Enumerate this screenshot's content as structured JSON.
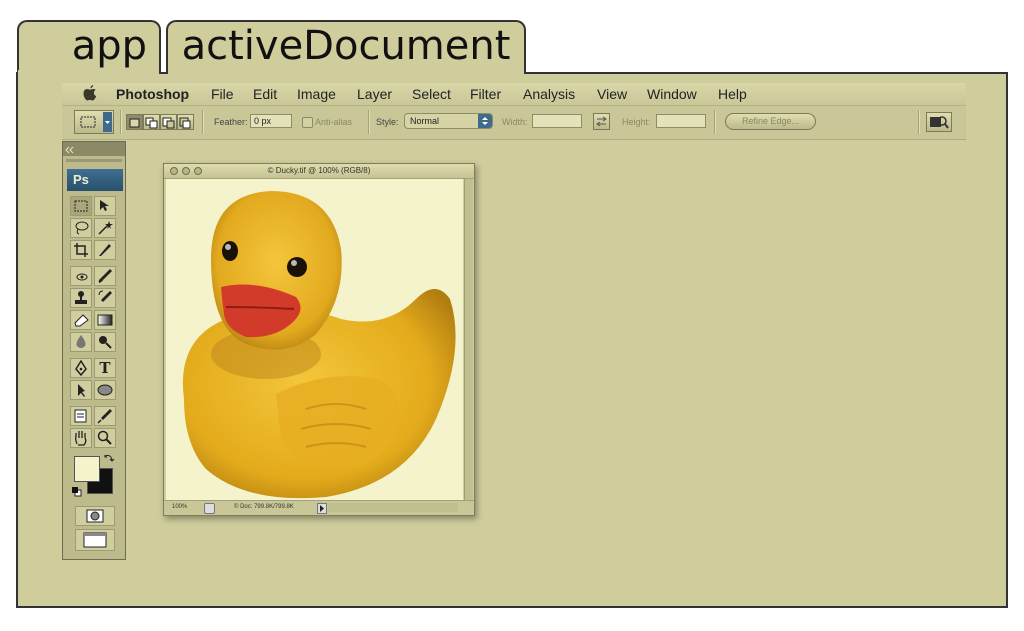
{
  "labels": {
    "tab_app": "app",
    "tab_document": "activeDocument"
  },
  "menubar": {
    "app_name": "Photoshop",
    "items": [
      "File",
      "Edit",
      "Image",
      "Layer",
      "Select",
      "Filter",
      "Analysis",
      "View",
      "Window",
      "Help"
    ]
  },
  "options_bar": {
    "feather_label": "Feather:",
    "feather_value": "0 px",
    "antialias_label": "Anti-alias",
    "style_label": "Style:",
    "style_value": "Normal",
    "width_label": "Width:",
    "height_label": "Height:",
    "refine_edge_label": "Refine Edge..."
  },
  "toolbox": {
    "logo": "Ps"
  },
  "document": {
    "title": "© Ducky.tif @ 100% (RGB/8)",
    "zoom": "100%",
    "doc_info": "© Doc: 799.8K/799.8K"
  }
}
